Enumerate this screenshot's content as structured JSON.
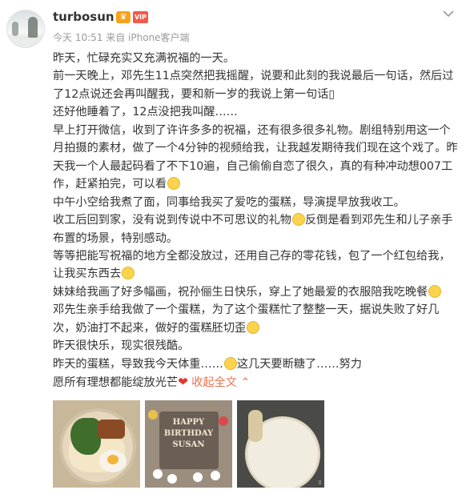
{
  "header": {
    "username": "turbosun",
    "meta": "今天 10:51 来自 iPhone客户端",
    "badge_crown": "♛",
    "badge_vip": "VIP"
  },
  "post": {
    "lines": [
      "昨天，忙碌充实又充满祝福的一天。",
      "前一天晚上，邓先生11点突然把我摇醒，说要和此刻的我说最后一句话，然后过了12点说还会再叫醒我，要和新一岁的我说上第一句话▯",
      "还好他睡着了，12点没把我叫醒……",
      "早上打开微信，收到了许许多多的祝福，还有很多很多礼物。剧组特别用这一个月拍摄的素材，做了一个4分钟的视频给我，让我越发期待我们现在这个戏了。昨天我一个人最起码看了不下10遍，自己偷偷自恋了很久，真的有种冲动想007工作，赶紧拍完，可以看",
      "中午小空给我煮了面，同事给我买了爱吃的蛋糕，导演提早放我收工。",
      "收工后回到家，没有说到传说中不可思议的礼物",
      "反倒是看到邓先生和儿子亲手布置的场景，特别感动。",
      "等等把能写祝福的地方全都没放过，还用自己存的零花钱，包了一个红包给我，让我买东西去",
      "妹妹给我画了好多幅画，祝孙俪生日快乐，穿上了她最爱的衣服陪我吃晚餐",
      "邓先生亲手给我做了一个蛋糕，为了这个蛋糕忙了整整一天，据说失败了好几次，奶油打不起来，做好的蛋糕胚切歪",
      "昨天很快乐，现实很残酷。",
      "昨天的蛋糕，导致我今天体重……",
      "这几天要断糖了……努力",
      "愿所有理想都能绽放光芒",
      "收起全文"
    ]
  },
  "photos": {
    "pic2_text_1": "HAPPY",
    "pic2_text_2": "BIRTHDAY",
    "pic2_text_3": "SUSAN"
  }
}
